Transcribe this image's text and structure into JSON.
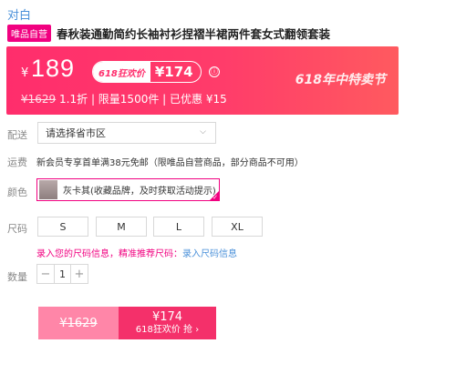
{
  "brand": "对白",
  "badge": "唯品自营",
  "title": "春秋装通勤简约长袖衬衫捏褶半裙两件套女式翻领套装",
  "price": {
    "currency": "¥",
    "current": "189",
    "promo_tag": "618狂欢价",
    "promo_price": "¥174",
    "info_icon": "ⓘ",
    "original": "¥1629",
    "discount": "1.1折",
    "limit": "限量1500件",
    "saved": "已优惠 ¥15",
    "festival": "618年中特卖节"
  },
  "delivery": {
    "label": "配送",
    "placeholder": "请选择省市区"
  },
  "shipping": {
    "label": "运费",
    "text": "新会员专享首单满38元免邮（限唯品自营商品，部分商品不可用）"
  },
  "color": {
    "label": "颜色",
    "option": "灰卡其(收藏品牌，及时获取活动提示)"
  },
  "size": {
    "label": "尺码",
    "options": [
      "S",
      "M",
      "L",
      "XL"
    ],
    "hint": "录入您的尺码信息，精准推荐尺码：",
    "hint_link": "录入尺码信息"
  },
  "quantity": {
    "label": "数量",
    "minus": "−",
    "value": "1",
    "plus": "+"
  },
  "buy": {
    "original": "¥1629",
    "promo_price": "¥174",
    "cta": "618狂欢价 抢 ›"
  },
  "colors": {
    "accent": "#f10180",
    "banner": "#ff2d6c",
    "link": "#4a90d9"
  }
}
